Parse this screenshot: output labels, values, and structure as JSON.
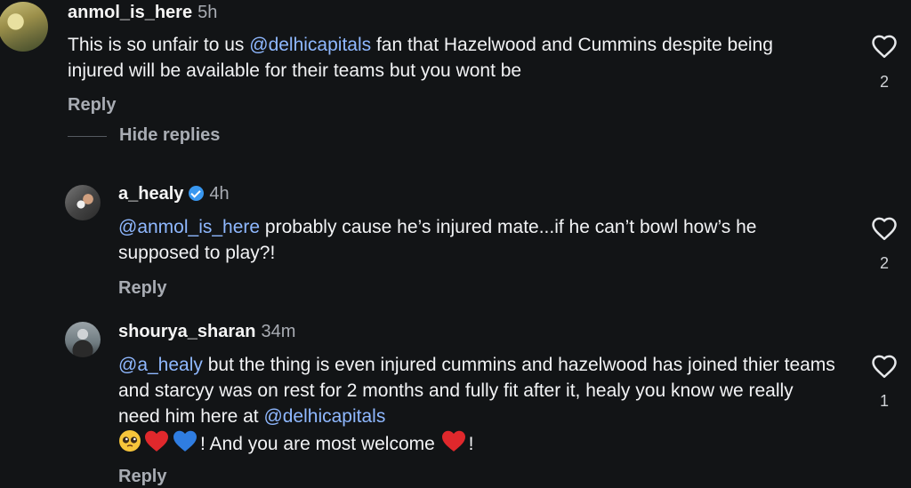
{
  "comments": [
    {
      "username": "anmol_is_here",
      "time": "5h",
      "text_a": "This is so unfair to us ",
      "mention_a": "@delhicapitals",
      "text_b": " fan that Hazelwood and Cummins despite being injured will be available for their teams but you wont be",
      "reply": "Reply",
      "likes": "2",
      "hide_replies": "Hide replies"
    },
    {
      "username": "a_healy",
      "verified": true,
      "time": "4h",
      "mention_a": "@anmol_is_here",
      "text_a": " probably cause he’s injured mate...if he can’t bowl how’s he supposed to play?!",
      "reply": "Reply",
      "likes": "2"
    },
    {
      "username": "shourya_sharan",
      "time": "34m",
      "mention_a": "@a_healy",
      "text_a": " but the thing is even injured cummins and hazelwood has joined thier teams and starcyy was on rest for 2 months and fully fit after it, healy you know we really need him here at ",
      "mention_b": "@delhicapitals",
      "text_b": "! And you are  most welcome ",
      "text_c": "!",
      "reply": "Reply",
      "likes": "1"
    }
  ],
  "icons": [
    "heart-outline-icon",
    "verified-badge-icon",
    "pleading-face-emoji",
    "red-heart-emoji",
    "blue-heart-emoji"
  ],
  "colors": {
    "background": "#121416",
    "mention": "#8fb8ff",
    "muted": "#a8acb3",
    "verified": "#3897f0"
  }
}
